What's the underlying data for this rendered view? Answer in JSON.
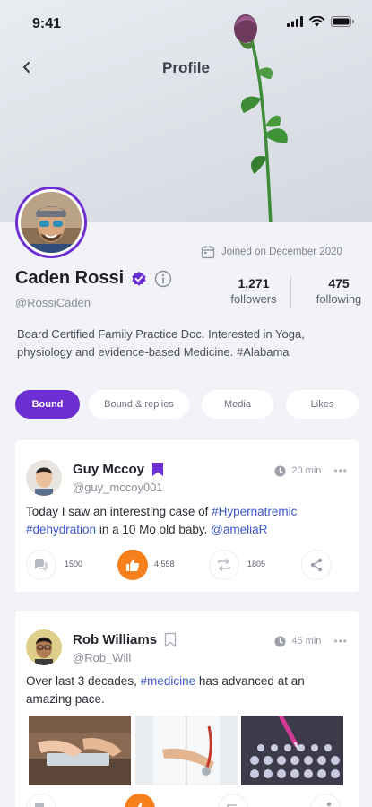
{
  "status_bar": {
    "time": "9:41"
  },
  "header": {
    "title": "Profile"
  },
  "profile": {
    "name": "Caden Rossi",
    "handle": "@RossiCaden",
    "joined": "Joined on December 2020",
    "followers_count": "1,271",
    "followers_label": "followers",
    "following_count": "475",
    "following_label": "following",
    "bio": "Board Certified Family Practice Doc. Interested in Yoga, physiology and evidence-based Medicine. #Alabama"
  },
  "tabs": [
    {
      "label": "Bound",
      "active": true
    },
    {
      "label": "Bound & replies",
      "active": false
    },
    {
      "label": "Media",
      "active": false
    },
    {
      "label": "Likes",
      "active": false
    }
  ],
  "posts": [
    {
      "author": "Guy Mccoy",
      "handle": "@guy_mccoy001",
      "time": "20 min",
      "bookmarked": true,
      "text_parts": {
        "t1": "Today I saw an interesting case of ",
        "tag1": "#Hypernatremic",
        "tag2": "#dehydration",
        "t2": " in a 10 Mo old baby. ",
        "mention": "@ameliaR"
      },
      "comments": "1500",
      "likes": "4,558",
      "rebounds": "1805"
    },
    {
      "author": "Rob Williams",
      "handle": "@Rob_Will",
      "time": "45 min",
      "bookmarked": false,
      "text_parts": {
        "t1": "Over last 3 decades, ",
        "tag1": "#medicine",
        "t2": " has advanced at an amazing pace."
      }
    }
  ],
  "icons": {
    "back": "chevron-left-icon",
    "verified": "verified-badge-icon",
    "info": "info-icon",
    "calendar": "calendar-icon",
    "clock": "clock-icon",
    "comment": "comment-icon",
    "like": "thumbs-up-icon",
    "rebound": "repeat-icon",
    "share": "share-icon",
    "bookmark": "bookmark-icon"
  },
  "colors": {
    "accent": "#6d2ed4",
    "like": "#f5801c",
    "hashtag": "#3c59c9"
  }
}
